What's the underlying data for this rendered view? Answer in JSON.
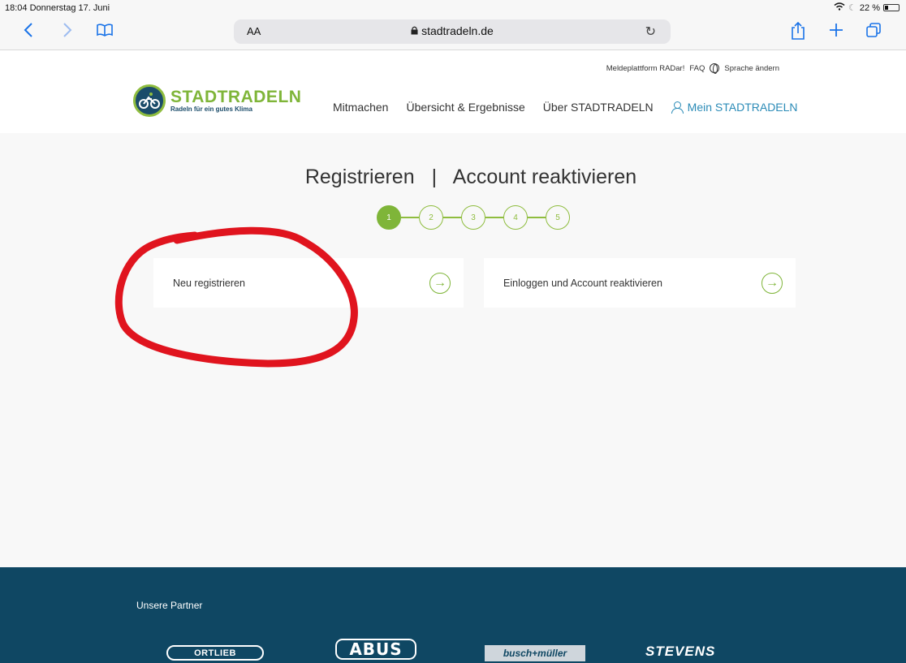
{
  "status_bar": {
    "time_date": "18:04  Donnerstag 17. Juni",
    "battery": "22 %"
  },
  "browser": {
    "text_size_label": "AA",
    "url": "stadtradeln.de",
    "icons": {
      "back": "chevron-left-icon",
      "forward": "chevron-right-icon",
      "bookmarks": "book-icon",
      "reload": "reload-icon",
      "share": "share-icon",
      "new_tab": "plus-icon",
      "tabs": "tabs-icon"
    }
  },
  "header": {
    "meta_nav": {
      "radar": "Meldeplattform RADar!",
      "faq": "FAQ",
      "language": "Sprache ändern"
    },
    "logo": {
      "title": "STADTRADELN",
      "subtitle": "Radeln für ein gutes Klima"
    },
    "nav": [
      "Mitmachen",
      "Übersicht & Ergebnisse",
      "Über STADTRADELN",
      "Mein STADTRADELN"
    ]
  },
  "main": {
    "title_left": "Registrieren",
    "title_sep": "|",
    "title_right": "Account reaktivieren",
    "steps": [
      "1",
      "2",
      "3",
      "4",
      "5"
    ],
    "active_step": 1,
    "cards": [
      {
        "label": "Neu registrieren",
        "icon": "arrow-right-circle-icon"
      },
      {
        "label": "Einloggen und Account reaktivieren",
        "icon": "arrow-right-circle-icon"
      }
    ]
  },
  "footer": {
    "partners_title": "Unsere Partner",
    "partners": [
      "ORTLIEB",
      "ABUS",
      "busch+müller",
      "STEVENS"
    ]
  },
  "colors": {
    "brand_green": "#7fb539",
    "brand_blue": "#2b8bb7",
    "footer_bg": "#0f4763",
    "annotation_red": "#e0141e"
  }
}
